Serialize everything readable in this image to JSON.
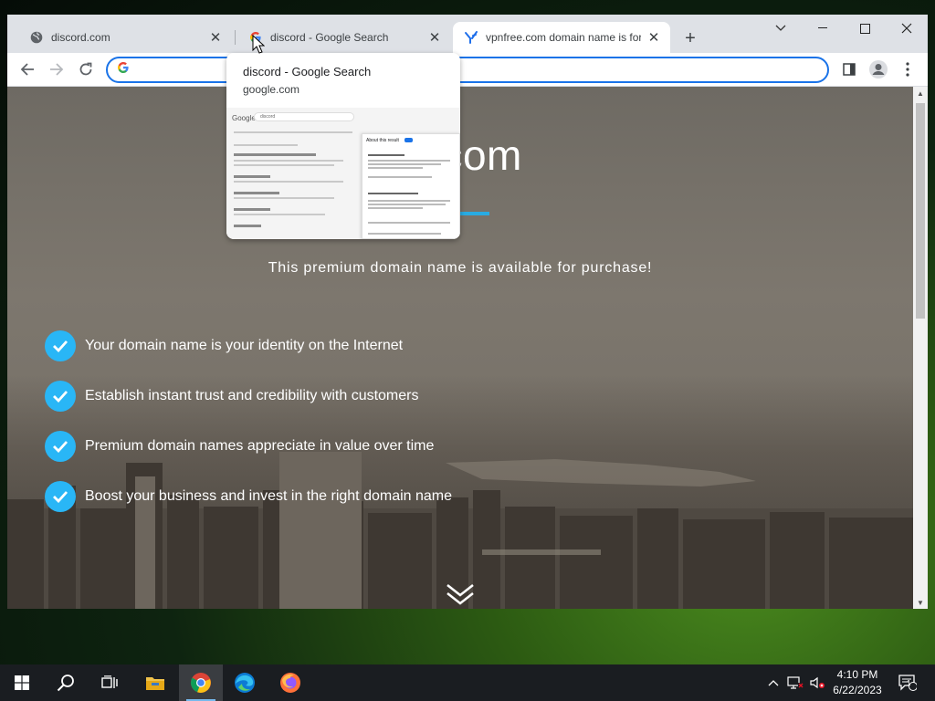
{
  "browser": {
    "tabs": [
      {
        "title": "discord.com",
        "favicon": "globe-icon",
        "active": false
      },
      {
        "title": "discord - Google Search",
        "favicon": "google-icon",
        "active": false
      },
      {
        "title": "vpnfree.com domain name is for sale",
        "favicon": "yandex-y-icon",
        "active": true
      }
    ],
    "address_value": "",
    "hover_card": {
      "title": "discord - Google Search",
      "domain": "google.com",
      "preview": {
        "logo": "Google",
        "query": "discord",
        "about_title": "About this result"
      }
    }
  },
  "page": {
    "headline_visible": "e.com",
    "subtitle": "This premium domain name is available for purchase!",
    "benefits": [
      "Your domain name is your identity on the Internet",
      "Establish instant trust and credibility with customers",
      "Premium domain names appreciate in value over time",
      "Boost your business and invest in the right domain name"
    ],
    "accent_color": "#29abe2"
  },
  "taskbar": {
    "apps": [
      "windows-start-icon",
      "search-icon",
      "task-view-icon",
      "file-explorer-icon",
      "chrome-icon",
      "edge-icon",
      "firefox-icon"
    ],
    "clock": {
      "time": "4:10 PM",
      "date": "6/22/2023"
    },
    "notification_count": "1"
  }
}
